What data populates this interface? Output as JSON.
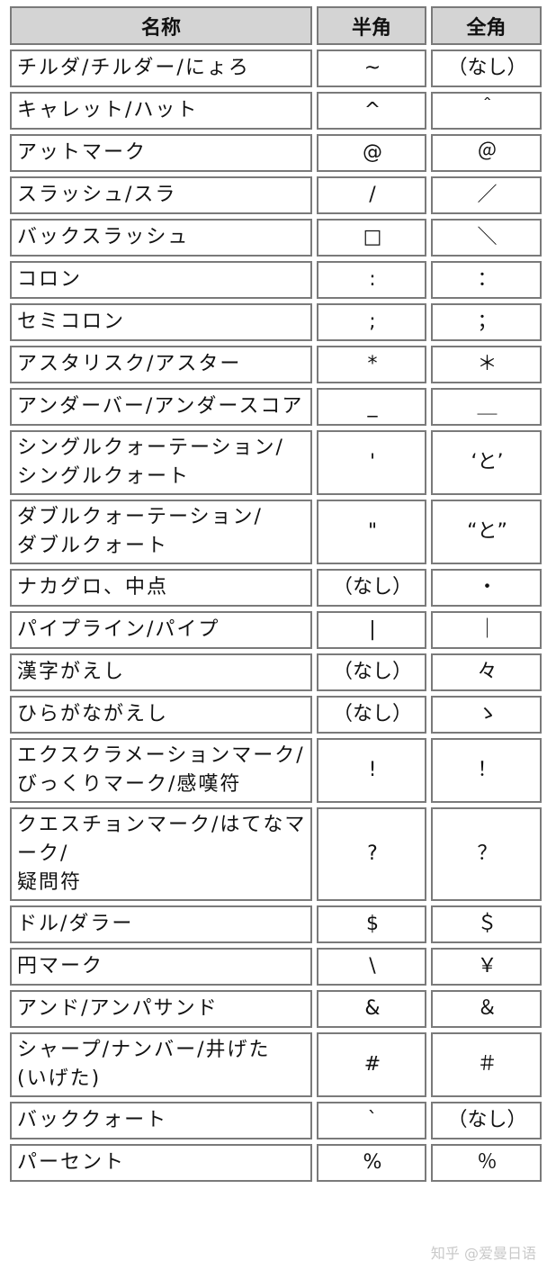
{
  "headers": [
    "名称",
    "半角",
    "全角"
  ],
  "rows": [
    {
      "name": "チルダ/チルダー/にょろ",
      "half": "~",
      "full": "（なし）"
    },
    {
      "name": "キャレット/ハット",
      "half": "^",
      "full": "＾"
    },
    {
      "name": "アットマーク",
      "half": "@",
      "full": "＠"
    },
    {
      "name": "スラッシュ/スラ",
      "half": "/",
      "full": "／"
    },
    {
      "name": "バックスラッシュ",
      "half": "□",
      "full": "＼"
    },
    {
      "name": "コロン",
      "half": ":",
      "full": "："
    },
    {
      "name": "セミコロン",
      "half": ";",
      "full": "；"
    },
    {
      "name": "アスタリスク/アスター",
      "half": "*",
      "full": "＊"
    },
    {
      "name": "アンダーバー/アンダースコア",
      "half": "_",
      "full": "＿"
    },
    {
      "name": "シングルクォーテーション/\nシングルクォート",
      "half": "'",
      "full": "‘と’"
    },
    {
      "name": "ダブルクォーテーション/\nダブルクォート",
      "half": "\"",
      "full": "“と”"
    },
    {
      "name": "ナカグロ、中点",
      "half": "（なし）",
      "full": "・"
    },
    {
      "name": "パイプライン/パイプ",
      "half": "|",
      "full": "｜"
    },
    {
      "name": "漢字がえし",
      "half": "（なし）",
      "full": "々"
    },
    {
      "name": "ひらがながえし",
      "half": "（なし）",
      "full": "ゝ"
    },
    {
      "name": "エクスクラメーションマーク/\nびっくりマーク/感嘆符",
      "half": "!",
      "full": "！"
    },
    {
      "name": "クエスチョンマーク/はてなマーク/\n疑問符",
      "half": "?",
      "full": "？"
    },
    {
      "name": "ドル/ダラー",
      "half": "$",
      "full": "＄"
    },
    {
      "name": "円マーク",
      "half": "\\",
      "full": "￥"
    },
    {
      "name": "アンド/アンパサンド",
      "half": "&",
      "full": "＆"
    },
    {
      "name": "シャープ/ナンバー/井げた\n(いげた)",
      "half": "#",
      "full": "＃"
    },
    {
      "name": "バッククォート",
      "half": "`",
      "full": "（なし）"
    },
    {
      "name": "パーセント",
      "half": "%",
      "full": "％"
    }
  ],
  "watermark": "知乎 @爱曼日语"
}
